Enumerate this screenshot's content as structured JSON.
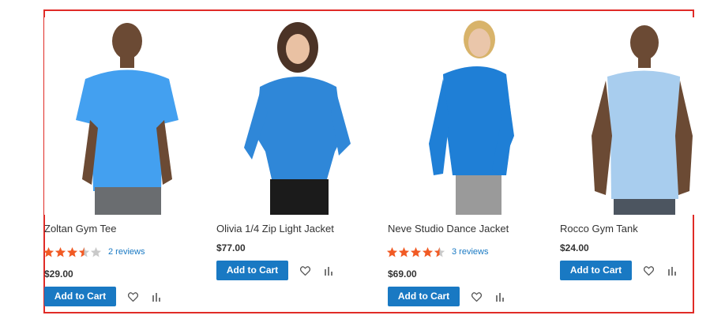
{
  "colors": {
    "accent": "#1979c3",
    "frame": "#e02b27",
    "star_filled": "#f15a24",
    "star_empty": "#c9c9c9",
    "text": "#333333"
  },
  "products": [
    {
      "name": "Zoltan Gym Tee",
      "rating_stars": 3.5,
      "reviews_label": "2 reviews",
      "price": "$29.00",
      "add_to_cart_label": "Add to Cart",
      "wishlist_icon": "heart-icon",
      "compare_icon": "compare-bars-icon",
      "image": "man in blue short-sleeve gym tee"
    },
    {
      "name": "Olivia 1/4 Zip Light Jacket",
      "rating_stars": null,
      "reviews_label": null,
      "price": "$77.00",
      "add_to_cart_label": "Add to Cart",
      "wishlist_icon": "heart-icon",
      "compare_icon": "compare-bars-icon",
      "image": "woman in blue quarter-zip jacket"
    },
    {
      "name": "Neve Studio Dance Jacket",
      "rating_stars": 4.5,
      "reviews_label": "3 reviews",
      "price": "$69.00",
      "add_to_cart_label": "Add to Cart",
      "wishlist_icon": "heart-icon",
      "compare_icon": "compare-bars-icon",
      "image": "woman in blue long-sleeve jacket"
    },
    {
      "name": "Rocco Gym Tank",
      "rating_stars": null,
      "reviews_label": null,
      "price": "$24.00",
      "add_to_cart_label": "Add to Cart",
      "wishlist_icon": "heart-icon",
      "compare_icon": "compare-bars-icon",
      "image": "man in light blue sleeveless tank"
    }
  ]
}
